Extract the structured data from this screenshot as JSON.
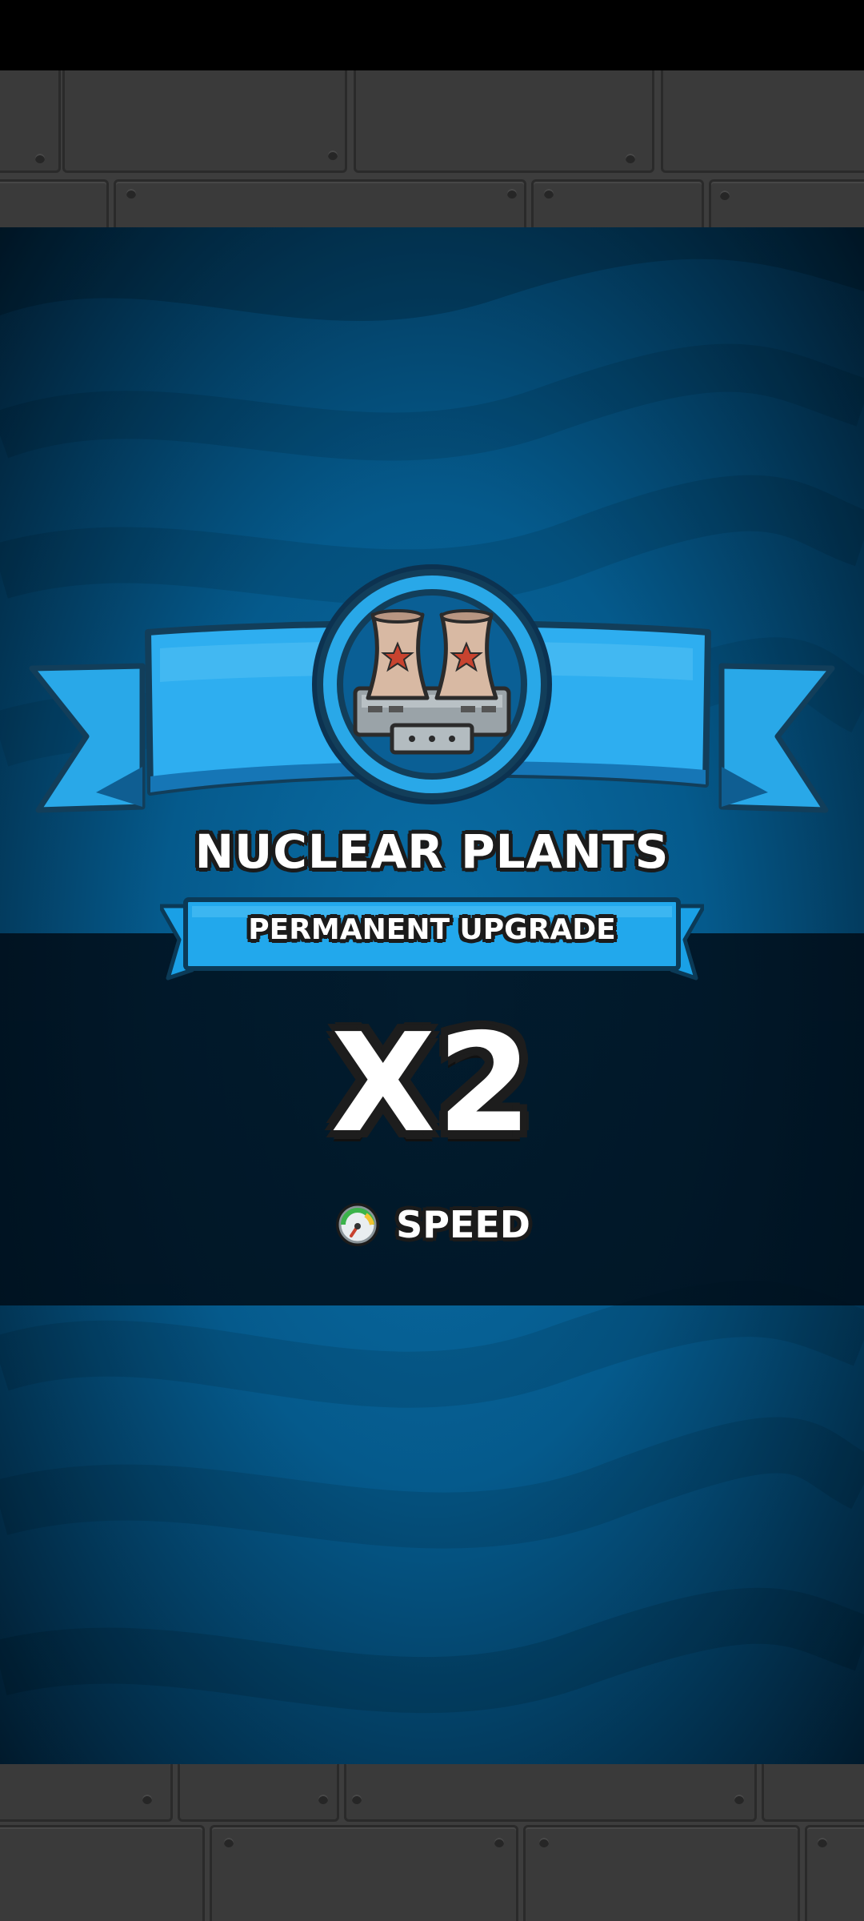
{
  "upgrade": {
    "title": "NUCLEAR PLANTS",
    "subtitle": "PERMANENT UPGRADE",
    "multiplier": "X2",
    "stat_label": "SPEED",
    "icon": "nuclear-plant-icon",
    "stat_icon": "speedometer-icon"
  },
  "colors": {
    "ribbon": "#29a8e8",
    "ribbon_dark": "#1676b6",
    "ocean": "#0a6fa8",
    "metal": "#3d3d3d"
  }
}
